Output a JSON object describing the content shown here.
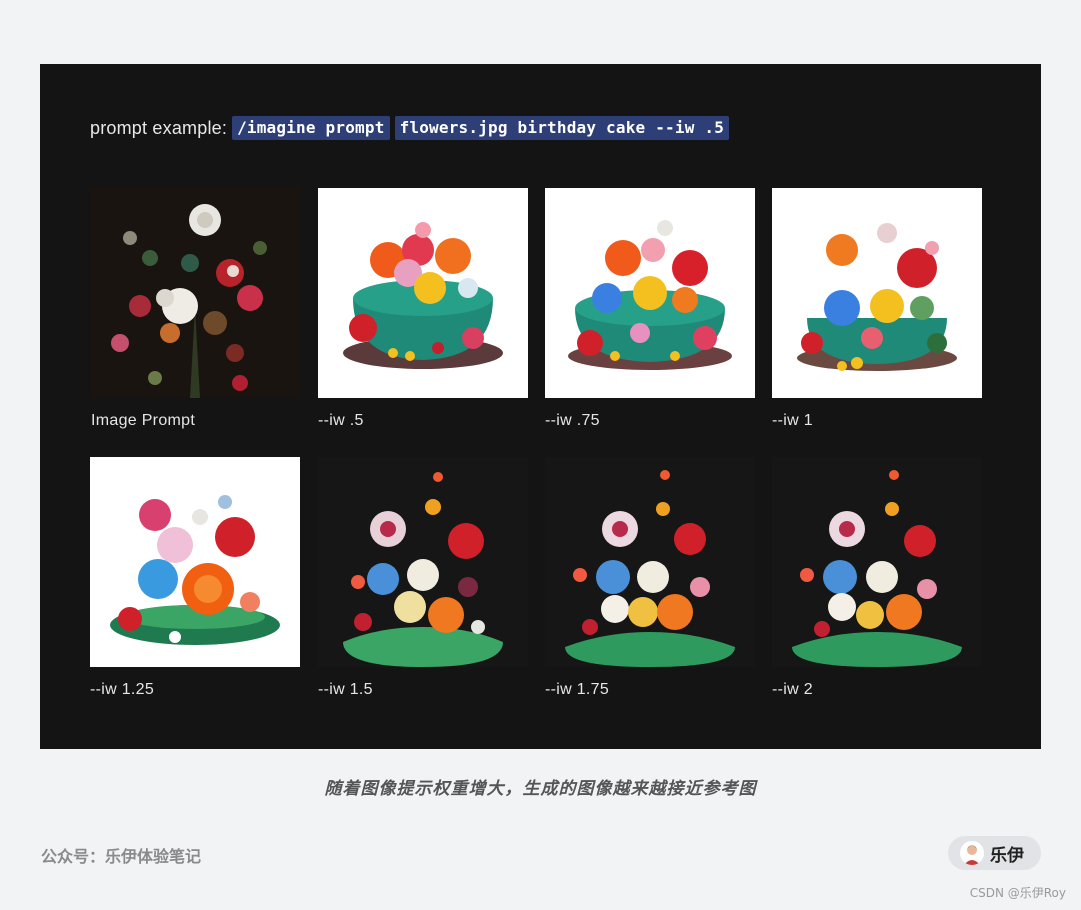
{
  "prompt": {
    "label": "prompt example:",
    "command": "/imagine prompt",
    "args": "flowers.jpg birthday cake --iw .5"
  },
  "grid": {
    "row1": [
      {
        "caption": "Image Prompt",
        "bg": "#1a1410",
        "style": "dark-bouquet"
      },
      {
        "caption": "--iw .5",
        "bg": "#ffffff",
        "style": "cake"
      },
      {
        "caption": "--iw .75",
        "bg": "#ffffff",
        "style": "cake"
      },
      {
        "caption": "--iw 1",
        "bg": "#ffffff",
        "style": "cake"
      }
    ],
    "row2": [
      {
        "caption": "--iw 1.25",
        "bg": "#ffffff",
        "style": "bouquet-cake"
      },
      {
        "caption": "--iw 1.5",
        "bg": "#161616",
        "style": "dark-cake"
      },
      {
        "caption": "--iw 1.75",
        "bg": "#161616",
        "style": "dark-cake"
      },
      {
        "caption": "--iw 2",
        "bg": "#161616",
        "style": "dark-cake"
      }
    ]
  },
  "subtitle": "随着图像提示权重增大，生成的图像越来越接近参考图",
  "footer": {
    "account": "公众号：乐伊体验笔记",
    "author": "乐伊",
    "watermark": "CSDN @乐伊Roy"
  },
  "colors": {
    "page_bg": "#f2f3f5",
    "panel_bg": "#141414",
    "code_chip": "#2e3f78",
    "cake_teal": "#1f8a78",
    "cake_green": "#3aa564"
  },
  "icons": {
    "avatar": "person-avatar-icon"
  }
}
